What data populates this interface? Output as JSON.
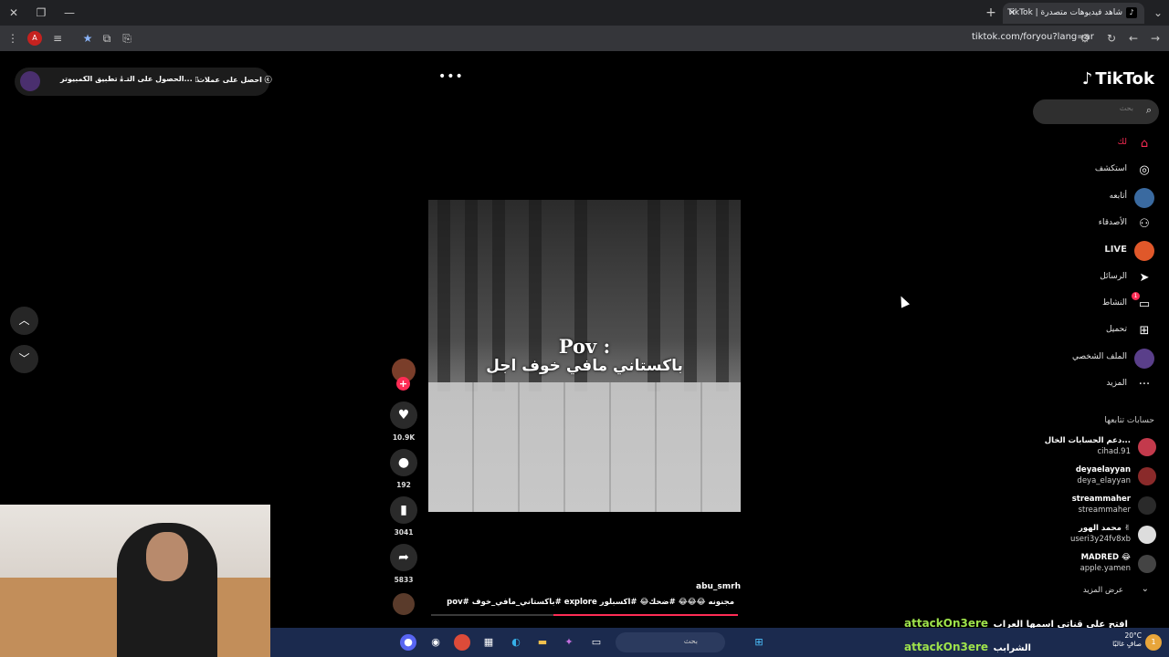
{
  "browser": {
    "tab_title": "شاهد فيديوهات متصدرة | TikTok",
    "url": "tiktok.com/foryou?lang=ar",
    "profile_initial": "A"
  },
  "topbar": {
    "get_coins": "احصل على عملات",
    "get_app": "الحصول على التـ...",
    "desktop_app": "تطبيق الكمبيوتر"
  },
  "logo": "TikTok",
  "search": {
    "placeholder": "بحث"
  },
  "nav": [
    {
      "label": "لك",
      "icon": "home-icon",
      "active": true
    },
    {
      "label": "استكشف",
      "icon": "compass-icon"
    },
    {
      "label": "أتابعه",
      "icon": "following-icon"
    },
    {
      "label": "الأصدقاء",
      "icon": "friends-icon"
    },
    {
      "label": "LIVE",
      "icon": "live-icon"
    },
    {
      "label": "الرسائل",
      "icon": "messages-icon"
    },
    {
      "label": "النشاط",
      "icon": "activity-icon",
      "badge": "1"
    },
    {
      "label": "تحميل",
      "icon": "upload-icon"
    },
    {
      "label": "الملف الشخصي",
      "icon": "profile-icon"
    },
    {
      "label": "المزيد",
      "icon": "more-icon"
    }
  ],
  "following": {
    "heading": "حسابات تتابعها",
    "accounts": [
      {
        "name": "دعم الحسابات الخال...",
        "handle": "cihad.91"
      },
      {
        "name": "deyaelayyan",
        "handle": "deya_elayyan"
      },
      {
        "name": "streammaher",
        "handle": "streammaher"
      },
      {
        "name": "محمد الهور ✌",
        "handle": "useri3y24fv8xb"
      },
      {
        "name": "MADRED 😂",
        "handle": "apple.yamen"
      }
    ],
    "see_more": "عرض المزيد"
  },
  "video": {
    "overlay_title": "Pov :",
    "overlay_subtitle": "باكستاني مافي خوف اجل",
    "author": "abu_smrh",
    "description": "مجنونه 😂😂😂 #ضحك😂 #اكسبلور explore #باكستاني_مافي_خوف #pov",
    "progress": 0.6,
    "likes": "10.9K",
    "comments": "192",
    "saves": "3041",
    "shares": "5833"
  },
  "chat": [
    {
      "user": "attackOn3ere",
      "message": "افتح على قناتي اسمها العراب"
    },
    {
      "user": "attackOn3ere",
      "message": "الشرابب"
    }
  ],
  "taskbar": {
    "search_label": "بحث",
    "temperature": "20°C",
    "weather": "صافٍ غالبًا",
    "notification_count": "1"
  },
  "colors": {
    "accent": "#fe2c55",
    "chat_user": "#9ee24b"
  }
}
